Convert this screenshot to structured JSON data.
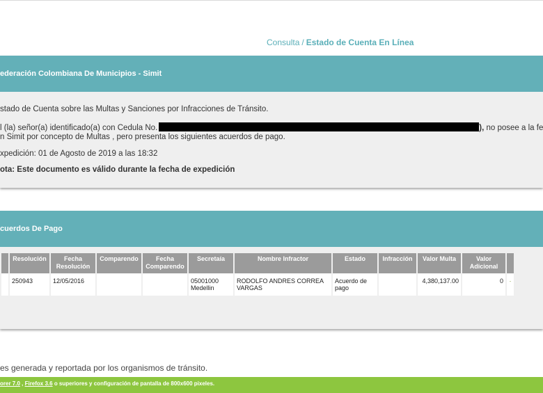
{
  "breadcrumb": {
    "root": "Consulta",
    "separator": "/",
    "current": "Estado de Cuenta En Línea"
  },
  "panel1": {
    "title": "ederación Colombiana De Municipios - Simit",
    "line1": "stado de Cuenta sobre las Multas y Sanciones por Infracciones de Tránsito.",
    "line2_prefix": "l (la) señor(a) identificado(a) con Cedula No.",
    "line2_suffix": "),",
    "line2_tail": " no posee a la fe",
    "line3": "n Simit por concepto de Multas , pero presenta los siguientes acuerdos de pago.",
    "expedition": "xpedición: 01 de Agosto de 2019 a las 18:32",
    "note": "ota: Este documento es válido durante la fecha de expedición"
  },
  "panel2": {
    "title": "cuerdos De Pago",
    "columns": [
      "Resolución",
      "Fecha Resolución",
      "Comparendo",
      "Fecha Comparendo",
      "Secretaía",
      "Nombre Infractor",
      "Estado",
      "Infracción",
      "Valor Multa",
      "Valor Adicional"
    ],
    "rows": [
      [
        "250943",
        "12/05/2016",
        "",
        "",
        "05001000 Medellin",
        "RODOLFO ANDRES CORREA VARGAS",
        "Acuerdo de pago",
        "",
        "4,380,137.00",
        "0"
      ]
    ]
  },
  "footer_note": "es generada y reportada por los organismos de tránsito.",
  "bottombar": {
    "link1": "orer 7.0",
    "sep": " , ",
    "link2": "Firefox 3.6",
    "text": " o superiores y configuración de pantalla de 800x600 pixeles."
  },
  "colors": {
    "header_teal": "#63b0b8",
    "breadcrumb_teal": "#5aafb8",
    "bottom_green": "#8dc63f",
    "table_header_gray": "#9b9b9b"
  }
}
